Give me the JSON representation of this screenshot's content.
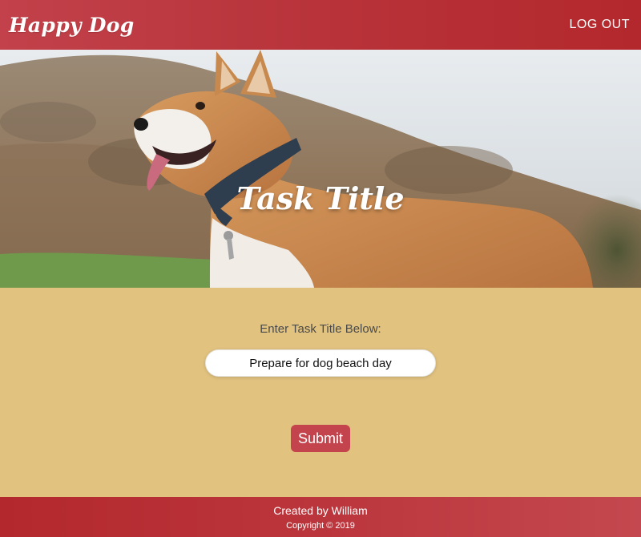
{
  "header": {
    "brand": "Happy Dog",
    "logout_label": "LOG OUT"
  },
  "hero": {
    "title": "Task Title",
    "image_subject": "corgi-dog-photo"
  },
  "form": {
    "label": "Enter Task Title Below:",
    "input_value": "Prepare for dog beach day",
    "submit_label": "Submit"
  },
  "footer": {
    "credit": "Created by William",
    "copyright": "Copyright © 2019"
  },
  "colors": {
    "header_red": "#b8333a",
    "form_background": "#e1c27f",
    "submit_button": "#c4444d",
    "footer_red": "#bb363c"
  }
}
